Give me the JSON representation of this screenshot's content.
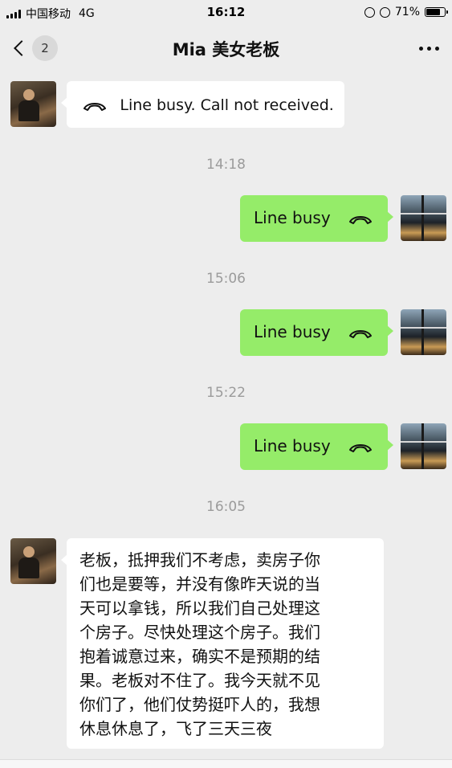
{
  "status_bar": {
    "carrier": "中国移动",
    "network": "4G",
    "time": "16:12",
    "battery_percent": "71%",
    "battery_level": 0.71
  },
  "header": {
    "back_badge": "2",
    "title": "Mia 美女老板",
    "more_icon": "more-dots-icon"
  },
  "messages": [
    {
      "from": "contact",
      "type": "call",
      "text": "Line busy. Call not received.",
      "icon": "phone-hangup-icon"
    },
    {
      "type": "timestamp",
      "text": "14:18"
    },
    {
      "from": "me",
      "type": "call",
      "text": "Line busy",
      "icon": "phone-hangup-icon"
    },
    {
      "type": "timestamp",
      "text": "15:06"
    },
    {
      "from": "me",
      "type": "call",
      "text": "Line busy",
      "icon": "phone-hangup-icon"
    },
    {
      "type": "timestamp",
      "text": "15:22"
    },
    {
      "from": "me",
      "type": "call",
      "text": "Line busy",
      "icon": "phone-hangup-icon"
    },
    {
      "type": "timestamp",
      "text": "16:05"
    },
    {
      "from": "contact",
      "type": "text",
      "lines": [
        "老板，抵押我们不考虑，卖房子你",
        "们也是要等，并没有像昨天说的当",
        "天可以拿钱，所以我们自己处理这",
        "个房子。尽快处理这个房子。我们",
        "抱着诚意过来，确实不是预期的结",
        "果。老板对不住了。我今天就不见",
        "你们了，他们仗势挺吓人的，我想",
        "休息休息了，飞了三天三夜"
      ]
    }
  ],
  "colors": {
    "background": "#ededed",
    "bubble_me": "#95ec69",
    "bubble_contact": "#ffffff",
    "timestamp": "#9b9b9b"
  }
}
